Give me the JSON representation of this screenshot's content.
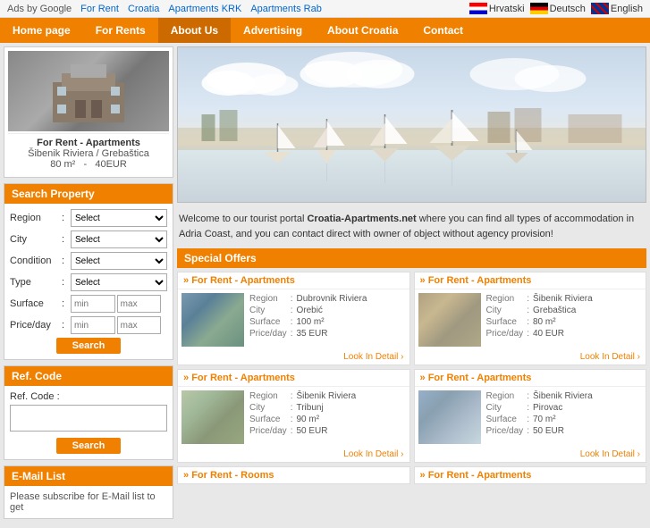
{
  "ads": {
    "label": "Ads by Google",
    "links": [
      "For Rent",
      "Croatia",
      "Apartments KRK",
      "Apartments Rab"
    ]
  },
  "languages": [
    {
      "name": "Hrvatski",
      "flag": "hr"
    },
    {
      "name": "Deutsch",
      "flag": "de"
    },
    {
      "name": "English",
      "flag": "en"
    }
  ],
  "nav": {
    "items": [
      {
        "label": "Home page",
        "active": false
      },
      {
        "label": "For Rents",
        "active": false
      },
      {
        "label": "About Us",
        "active": true
      },
      {
        "label": "Advertising",
        "active": false
      },
      {
        "label": "About Croatia",
        "active": false
      },
      {
        "label": "Contact",
        "active": false
      }
    ]
  },
  "featured_property": {
    "title": "For Rent - Apartments",
    "location": "Šibenik Riviera / Grebaštica",
    "surface": "80 m²",
    "price": "40EUR"
  },
  "search": {
    "title": "Search Property",
    "fields": [
      {
        "label": "Region",
        "type": "select",
        "value": "Select"
      },
      {
        "label": "City",
        "type": "select",
        "value": "Select"
      },
      {
        "label": "Condition",
        "type": "select",
        "value": "Select"
      },
      {
        "label": "Type",
        "type": "select",
        "value": "Select"
      },
      {
        "label": "Surface",
        "type": "range",
        "min_placeholder": "min",
        "max_placeholder": "max"
      },
      {
        "label": "Price/day",
        "type": "range",
        "min_placeholder": "min",
        "max_placeholder": "max"
      }
    ],
    "button": "Search"
  },
  "ref_code": {
    "title": "Ref. Code",
    "label": "Ref. Code :",
    "button": "Search"
  },
  "email_list": {
    "title": "E-Mail List",
    "text": "Please subscribe for E-Mail list to get"
  },
  "welcome": {
    "text_before": "Welcome to our tourist portal ",
    "site_name": "Croatia-Apartments.net",
    "text_after": " where you can find all types of accommodation in Adria Coast, and you can contact direct with owner of object without agency provision!"
  },
  "special_offers": {
    "title": "Special Offers",
    "offers": [
      {
        "type": "For Rent - Apartments",
        "thumb_class": "offer-thumb-1",
        "details": [
          {
            "label": "Region",
            "value": "Dubrovnik Riviera"
          },
          {
            "label": "City",
            "value": "Orebić"
          },
          {
            "label": "Surface",
            "value": "100 m²"
          },
          {
            "label": "Price/day",
            "value": "35 EUR"
          }
        ],
        "link": "Look In Detail"
      },
      {
        "type": "For Rent - Apartments",
        "thumb_class": "offer-thumb-2",
        "details": [
          {
            "label": "Region",
            "value": "Šibenik Riviera"
          },
          {
            "label": "City",
            "value": "Grebaštica"
          },
          {
            "label": "Surface",
            "value": "80 m²"
          },
          {
            "label": "Price/day",
            "value": "40 EUR"
          }
        ],
        "link": "Look In Detail"
      },
      {
        "type": "For Rent - Apartments",
        "thumb_class": "offer-thumb-3",
        "details": [
          {
            "label": "Region",
            "value": "Šibenik Riviera"
          },
          {
            "label": "City",
            "value": "Tribunj"
          },
          {
            "label": "Surface",
            "value": "90 m²"
          },
          {
            "label": "Price/day",
            "value": "50 EUR"
          }
        ],
        "link": "Look In Detail"
      },
      {
        "type": "For Rent - Apartments",
        "thumb_class": "offer-thumb-4",
        "details": [
          {
            "label": "Region",
            "value": "Šibenik Riviera"
          },
          {
            "label": "City",
            "value": "Pirovac"
          },
          {
            "label": "Surface",
            "value": "70 m²"
          },
          {
            "label": "Price/day",
            "value": "50 EUR"
          }
        ],
        "link": "Look In Detail"
      }
    ],
    "more_row1_left": "For Rent - Rooms",
    "more_row1_right": "For Rent - Apartments"
  }
}
